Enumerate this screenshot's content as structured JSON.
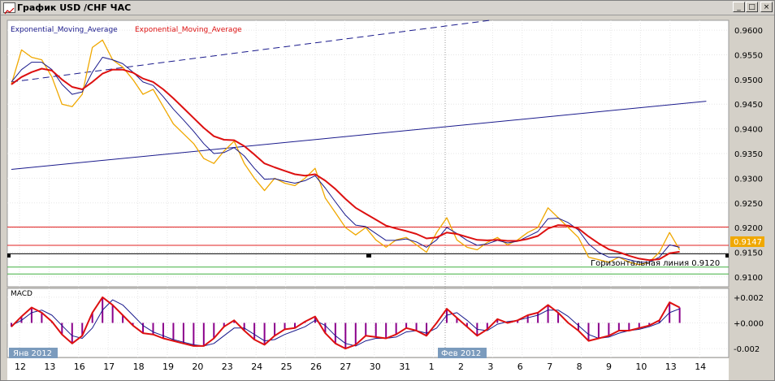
{
  "window": {
    "title": "График USD /CHF ЧАС",
    "buttons": {
      "minimize": "_",
      "restore": "□",
      "close": "×"
    }
  },
  "colors": {
    "price": "#f0a800",
    "ema_fast": "#1a1a8c",
    "ema_slow": "#dd1010",
    "trend": "#1a1a8c",
    "macd_hist": "#8b008b",
    "resistance": "#e02020",
    "support": "#40b040",
    "current_price_bg": "#f0a800"
  },
  "chart_data": [
    {
      "type": "line",
      "title": "",
      "legend": [
        "Exponential_Moving_Average",
        "Exponential_Moving_Average"
      ],
      "ylim": [
        0.9085,
        0.9615
      ],
      "y_ticks": [
        "0.9600",
        "0.9550",
        "0.9500",
        "0.9450",
        "0.9400",
        "0.9350",
        "0.9300",
        "0.9250",
        "0.9200",
        "0.9150",
        "0.9100"
      ],
      "x_ticks": [
        "12",
        "13",
        "16",
        "17",
        "18",
        "19",
        "20",
        "23",
        "24",
        "25",
        "26",
        "27",
        "30",
        "31",
        "1",
        "2",
        "3",
        "6",
        "7",
        "8",
        "9",
        "10",
        "13",
        "14"
      ],
      "date_labels": [
        "Янв 2012",
        "Фев 2012"
      ],
      "current_price": "0.9147",
      "horizontal_line_label": "Горизонтальная линия 0.9120",
      "horizontal_lines": [
        {
          "value": 0.9201,
          "color": "red"
        },
        {
          "value": 0.9164,
          "color": "red"
        },
        {
          "value": 0.9147,
          "color": "black"
        },
        {
          "value": 0.912,
          "color": "green"
        },
        {
          "value": 0.9106,
          "color": "green"
        }
      ],
      "trend_lines": [
        {
          "from": [
            0,
            0.9318
          ],
          "to": [
            23.5,
            0.9456
          ],
          "style": "solid"
        },
        {
          "from": [
            0,
            0.9495
          ],
          "to": [
            16.2,
            0.962
          ],
          "style": "dashed"
        }
      ],
      "series": [
        {
          "role": "price",
          "values": [
            0.949,
            0.956,
            0.9545,
            0.954,
            0.9505,
            0.945,
            0.9445,
            0.947,
            0.9565,
            0.958,
            0.954,
            0.9525,
            0.95,
            0.947,
            0.948,
            0.9445,
            0.941,
            0.939,
            0.937,
            0.934,
            0.933,
            0.9355,
            0.9375,
            0.933,
            0.93,
            0.9275,
            0.93,
            0.929,
            0.9285,
            0.93,
            0.932,
            0.926,
            0.923,
            0.92,
            0.9185,
            0.92,
            0.9175,
            0.916,
            0.9175,
            0.918,
            0.9165,
            0.915,
            0.919,
            0.922,
            0.9175,
            0.916,
            0.9155,
            0.917,
            0.918,
            0.9165,
            0.9175,
            0.919,
            0.92,
            0.924,
            0.922,
            0.92,
            0.918,
            0.914,
            0.9135,
            0.913,
            0.914,
            0.913,
            0.9125,
            0.913,
            0.915,
            0.919,
            0.9155
          ]
        },
        {
          "role": "ema_fast",
          "name": "Exponential_Moving_Average",
          "values": [
            0.9495,
            0.952,
            0.9535,
            0.9535,
            0.952,
            0.949,
            0.947,
            0.9475,
            0.9515,
            0.9545,
            0.954,
            0.9532,
            0.9515,
            0.9495,
            0.9488,
            0.9465,
            0.944,
            0.9418,
            0.9395,
            0.937,
            0.935,
            0.9352,
            0.9362,
            0.9345,
            0.932,
            0.9298,
            0.9299,
            0.9294,
            0.929,
            0.9295,
            0.9305,
            0.928,
            0.9252,
            0.9225,
            0.9205,
            0.9202,
            0.9188,
            0.9174,
            0.9174,
            0.9177,
            0.9171,
            0.916,
            0.9175,
            0.92,
            0.9188,
            0.9174,
            0.9164,
            0.9167,
            0.9174,
            0.9169,
            0.9172,
            0.9182,
            0.9192,
            0.9218,
            0.9219,
            0.921,
            0.9195,
            0.9167,
            0.915,
            0.914,
            0.914,
            0.9135,
            0.913,
            0.913,
            0.914,
            0.9165,
            0.916
          ]
        },
        {
          "role": "ema_slow",
          "name": "Exponential_Moving_Average",
          "values": [
            0.949,
            0.9505,
            0.9515,
            0.9522,
            0.9518,
            0.95,
            0.9485,
            0.948,
            0.9495,
            0.9512,
            0.952,
            0.952,
            0.9514,
            0.9502,
            0.9495,
            0.948,
            0.9462,
            0.9442,
            0.9422,
            0.9402,
            0.9385,
            0.9378,
            0.9377,
            0.9365,
            0.9348,
            0.933,
            0.9322,
            0.9315,
            0.9308,
            0.9305,
            0.9308,
            0.9295,
            0.9278,
            0.9258,
            0.924,
            0.9228,
            0.9216,
            0.9204,
            0.9198,
            0.9193,
            0.9187,
            0.9178,
            0.918,
            0.919,
            0.9187,
            0.9181,
            0.9175,
            0.9174,
            0.9175,
            0.9173,
            0.9173,
            0.9177,
            0.9183,
            0.9198,
            0.9205,
            0.9204,
            0.9198,
            0.9182,
            0.9168,
            0.9156,
            0.915,
            0.9143,
            0.9137,
            0.9134,
            0.9136,
            0.9148,
            0.9151
          ]
        }
      ]
    },
    {
      "type": "line",
      "title": "MACD",
      "ylim": [
        -0.0025,
        0.0025
      ],
      "y_ticks": [
        "+0.002",
        "+0.000",
        "-0.002"
      ],
      "series": [
        {
          "role": "macd_fast",
          "values": [
            -0.0003,
            0.0005,
            0.0012,
            0.0008,
            0.0001,
            -0.0009,
            -0.0016,
            -0.001,
            0.0008,
            0.002,
            0.0014,
            0.0006,
            -0.0002,
            -0.0008,
            -0.0009,
            -0.0012,
            -0.0014,
            -0.0016,
            -0.0018,
            -0.0018,
            -0.0012,
            -0.0003,
            0.0002,
            -0.0006,
            -0.0013,
            -0.0017,
            -0.001,
            -0.0005,
            -0.0004,
            0.0001,
            0.0005,
            -0.0008,
            -0.0016,
            -0.002,
            -0.0017,
            -0.001,
            -0.0011,
            -0.0012,
            -0.0009,
            -0.0004,
            -0.0006,
            -0.001,
            0.0,
            0.0011,
            0.0004,
            -0.0003,
            -0.001,
            -0.0005,
            0.0003,
            0.0,
            0.0002,
            0.0006,
            0.0008,
            0.0014,
            0.0008,
            0.0,
            -0.0006,
            -0.0014,
            -0.0012,
            -0.001,
            -0.0006,
            -0.0006,
            -0.0004,
            -0.0002,
            0.0002,
            0.0016,
            0.0012
          ]
        },
        {
          "role": "macd_signal",
          "values": [
            -0.0002,
            0.0002,
            0.0008,
            0.001,
            0.0006,
            -0.0002,
            -0.001,
            -0.0012,
            -0.0004,
            0.001,
            0.0018,
            0.0014,
            0.0006,
            -0.0002,
            -0.0007,
            -0.001,
            -0.0013,
            -0.0015,
            -0.0017,
            -0.0018,
            -0.0016,
            -0.001,
            -0.0004,
            -0.0004,
            -0.0009,
            -0.0014,
            -0.0013,
            -0.0009,
            -0.0006,
            -0.0003,
            0.0002,
            -0.0002,
            -0.001,
            -0.0016,
            -0.0018,
            -0.0014,
            -0.0012,
            -0.0012,
            -0.0011,
            -0.0007,
            -0.0006,
            -0.0008,
            -0.0004,
            0.0006,
            0.0008,
            0.0002,
            -0.0005,
            -0.0006,
            -0.0001,
            0.0001,
            0.0002,
            0.0004,
            0.0006,
            0.001,
            0.001,
            0.0005,
            -0.0002,
            -0.0009,
            -0.0012,
            -0.0011,
            -0.0008,
            -0.0006,
            -0.0005,
            -0.0003,
            0.0,
            0.0008,
            0.0011
          ]
        }
      ]
    }
  ]
}
